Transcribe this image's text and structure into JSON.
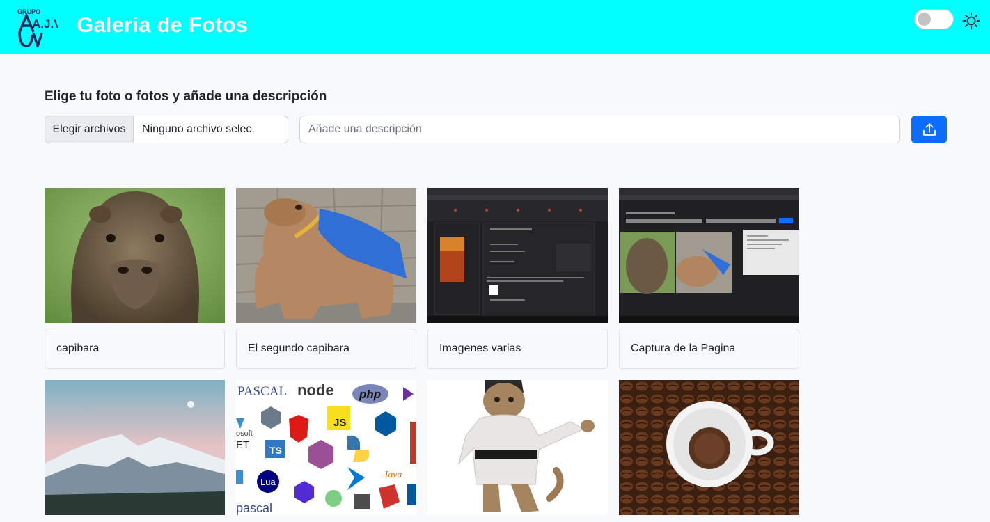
{
  "header": {
    "logo_text_top": "GRUPO",
    "logo_text_main": "A.J.V",
    "title": "Galeria de Fotos",
    "theme_toggle_state": "off",
    "accent": "#00ffff"
  },
  "upload": {
    "heading": "Elige tu foto o fotos y añade una descripción",
    "file_button_label": "Elegir archivos",
    "file_status": "Ninguno archivo selec.",
    "description_placeholder": "Añade una descripción",
    "submit_icon": "upload-icon",
    "submit_color": "#0d6efd"
  },
  "gallery": {
    "photos": [
      {
        "caption": "capibara",
        "image": "capybara-face"
      },
      {
        "caption": "El segundo capibara",
        "image": "capybara-cape"
      },
      {
        "caption": "Imagenes varias",
        "image": "screenshot-dark"
      },
      {
        "caption": "Captura de la Pagina",
        "image": "screenshot-gallery"
      },
      {
        "caption": "",
        "image": "snowy-mountains"
      },
      {
        "caption": "",
        "image": "programming-logos"
      },
      {
        "caption": "",
        "image": "karate-cat"
      },
      {
        "caption": "",
        "image": "coffee-cup"
      }
    ],
    "logo_labels": {
      "pascal_top": "PASCAL",
      "node": "node",
      "php": "php",
      "js": "JS",
      "ts": "TS",
      "lua": "Lua",
      "java": "Java",
      "pascal_bottom": "pascal",
      "net": "ET",
      "soft": "osoft"
    }
  }
}
